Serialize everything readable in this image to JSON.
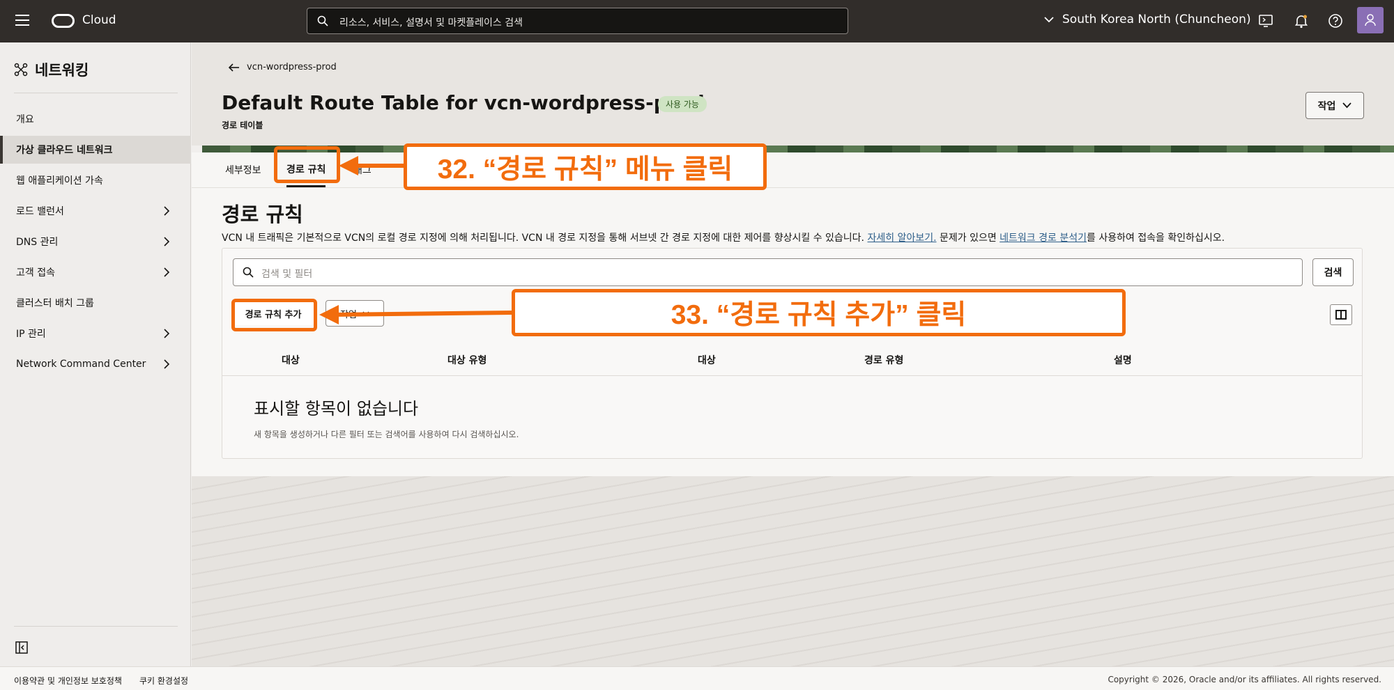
{
  "topbar": {
    "brand": "Cloud",
    "search_text": "리소스, 서비스, 설명서 및 마켓플레이스 검색",
    "region": "South Korea North (Chuncheon)"
  },
  "sidebar": {
    "title": "네트워킹",
    "items": [
      {
        "label": "개요",
        "has_chevron": false
      },
      {
        "label": "가상 클라우드 네트워크",
        "has_chevron": false,
        "active": true
      },
      {
        "label": "웹 애플리케이션 가속",
        "has_chevron": false
      },
      {
        "label": "로드 밸런서",
        "has_chevron": true
      },
      {
        "label": "DNS 관리",
        "has_chevron": true
      },
      {
        "label": "고객 접속",
        "has_chevron": true
      },
      {
        "label": "클러스터 배치 그룹",
        "has_chevron": false
      },
      {
        "label": "IP 관리",
        "has_chevron": true
      },
      {
        "label": "Network Command Center",
        "has_chevron": true
      }
    ]
  },
  "header": {
    "back_label": "vcn-wordpress-prod",
    "title": "Default Route Table for vcn-wordpress-prod",
    "status_badge": "사용 가능",
    "subtitle": "경로 테이블",
    "action_label": "작업"
  },
  "tabs": [
    {
      "label": "세부정보"
    },
    {
      "label": "경로 규칙",
      "active": true
    },
    {
      "label": "태그"
    }
  ],
  "section": {
    "title": "경로 규칙",
    "desc_part1": "VCN 내 트래픽은 기본적으로 VCN의 로컬 경로 지정에 의해 처리됩니다. VCN 내 경로 지정을 통해 서브넷 간 경로 지정에 대한 제어를 향상시킬 수 있습니다. ",
    "learn_more": "자세히 알아보기.",
    "desc_part2": " 문제가 있으면 ",
    "analyzer_link": "네트워크 경로 분석기",
    "desc_part3": "를 사용하여 접속을 확인하십시오."
  },
  "toolbar": {
    "filter_placeholder": "검색 및 필터",
    "search_button": "검색",
    "add_button": "경로 규칙 추가",
    "op_button": "작업"
  },
  "table": {
    "columns": [
      "대상",
      "대상 유형",
      "대상",
      "경로 유형",
      "설명"
    ],
    "empty_title": "표시할 항목이 없습니다",
    "empty_desc": "새 항목을 생성하거나 다른 필터 또는 검색어를 사용하여 다시 검색하십시오."
  },
  "annotations": {
    "step32": "32. “경로 규칙” 메뉴 클릭",
    "step33": "33. “경로 규칙 추가” 클릭",
    "color": "#f26c0d"
  },
  "footer": {
    "terms": "이용약관 및 개인정보 보호정책",
    "cookies": "쿠키 환경설정",
    "copyright": "Copyright © 2026, Oracle and/or its affiliates. All rights reserved."
  }
}
